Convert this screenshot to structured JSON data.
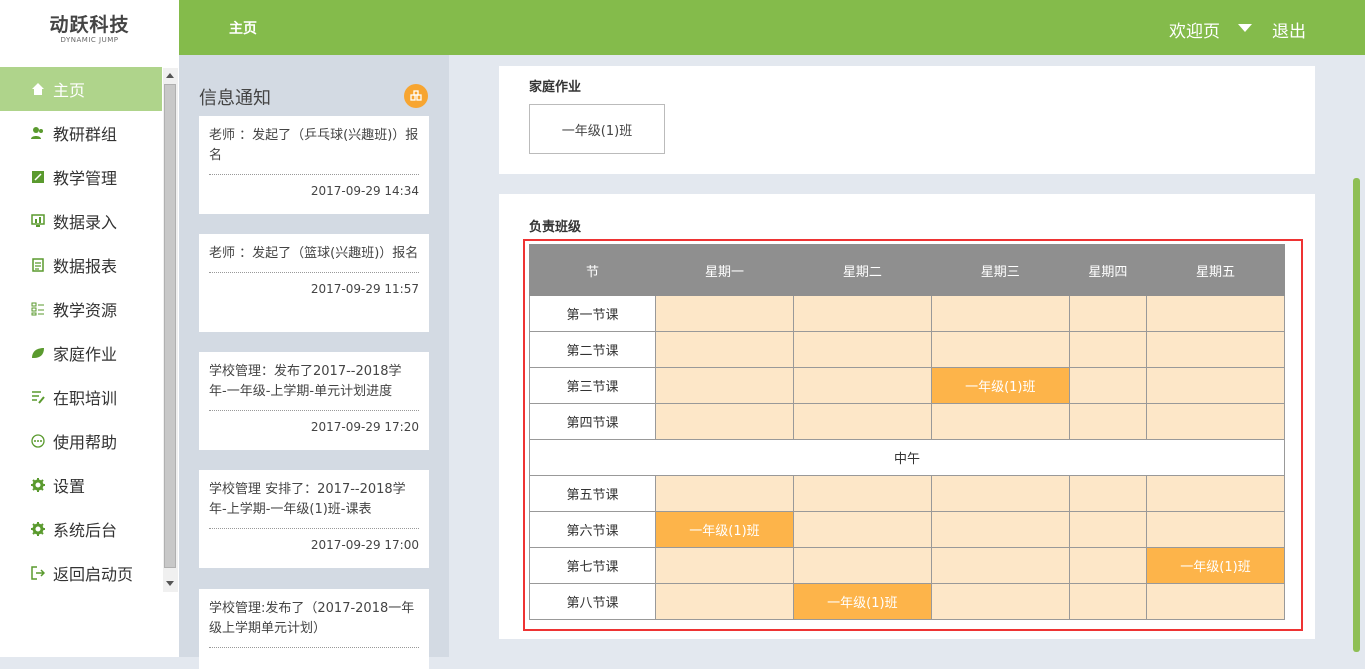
{
  "app": {
    "logo_title": "动跃科技",
    "logo_sub": "DYNAMIC JUMP"
  },
  "header": {
    "home": "主页",
    "welcome": "欢迎页",
    "logout": "退出"
  },
  "sidebar": {
    "items": [
      {
        "label": "主页",
        "icon": "home-icon"
      },
      {
        "label": "教研群组",
        "icon": "users-icon"
      },
      {
        "label": "教学管理",
        "icon": "edit-icon"
      },
      {
        "label": "数据录入",
        "icon": "chart-icon"
      },
      {
        "label": "数据报表",
        "icon": "report-icon"
      },
      {
        "label": "教学资源",
        "icon": "list-icon"
      },
      {
        "label": "家庭作业",
        "icon": "leaf-icon"
      },
      {
        "label": "在职培训",
        "icon": "training-icon"
      },
      {
        "label": "使用帮助",
        "icon": "dots-icon"
      },
      {
        "label": "设置",
        "icon": "gear-icon"
      },
      {
        "label": "系统后台",
        "icon": "gear-icon"
      },
      {
        "label": "返回启动页",
        "icon": "exit-icon"
      }
    ]
  },
  "notice": {
    "title": "信息通知",
    "items": [
      {
        "text": "老师 ：发起了（乒乓球(兴趣班)）报名",
        "date": "2017-09-29 14:34"
      },
      {
        "text": "老师 ：发起了（篮球(兴趣班)）报名",
        "date": "2017-09-29 11:57"
      },
      {
        "text": "学校管理：发布了2017--2018学年-一年级-上学期-单元计划进度",
        "date": "2017-09-29 17:20"
      },
      {
        "text": "学校管理 安排了：2017--2018学年-上学期-一年级(1)班-课表",
        "date": "2017-09-29 17:00"
      },
      {
        "text": "学校管理:发布了（2017-2018一年级上学期单元计划）",
        "date": ""
      }
    ]
  },
  "homework": {
    "title": "家庭作业",
    "class": "一年级(1)班"
  },
  "schedule": {
    "title": "负责班级",
    "headers": [
      "节",
      "星期一",
      "星期二",
      "星期三",
      "星期四",
      "星期五"
    ],
    "noon": "中午",
    "rows": [
      {
        "label": "第一节课",
        "cells": [
          "",
          "",
          "",
          "",
          ""
        ]
      },
      {
        "label": "第二节课",
        "cells": [
          "",
          "",
          "",
          "",
          ""
        ]
      },
      {
        "label": "第三节课",
        "cells": [
          "",
          "",
          "一年级(1)班",
          "",
          ""
        ]
      },
      {
        "label": "第四节课",
        "cells": [
          "",
          "",
          "",
          "",
          ""
        ]
      },
      {
        "label": "第五节课",
        "cells": [
          "",
          "",
          "",
          "",
          ""
        ]
      },
      {
        "label": "第六节课",
        "cells": [
          "一年级(1)班",
          "",
          "",
          "",
          ""
        ]
      },
      {
        "label": "第七节课",
        "cells": [
          "",
          "",
          "",
          "",
          "一年级(1)班"
        ]
      },
      {
        "label": "第八节课",
        "cells": [
          "",
          "一年级(1)班",
          "",
          "",
          ""
        ]
      }
    ]
  },
  "colors": {
    "header": "#84bb4b",
    "active": "#afd48b",
    "cell": "#fde7c8",
    "class_cell": "#fdb44a",
    "th": "#8f8f8f"
  }
}
